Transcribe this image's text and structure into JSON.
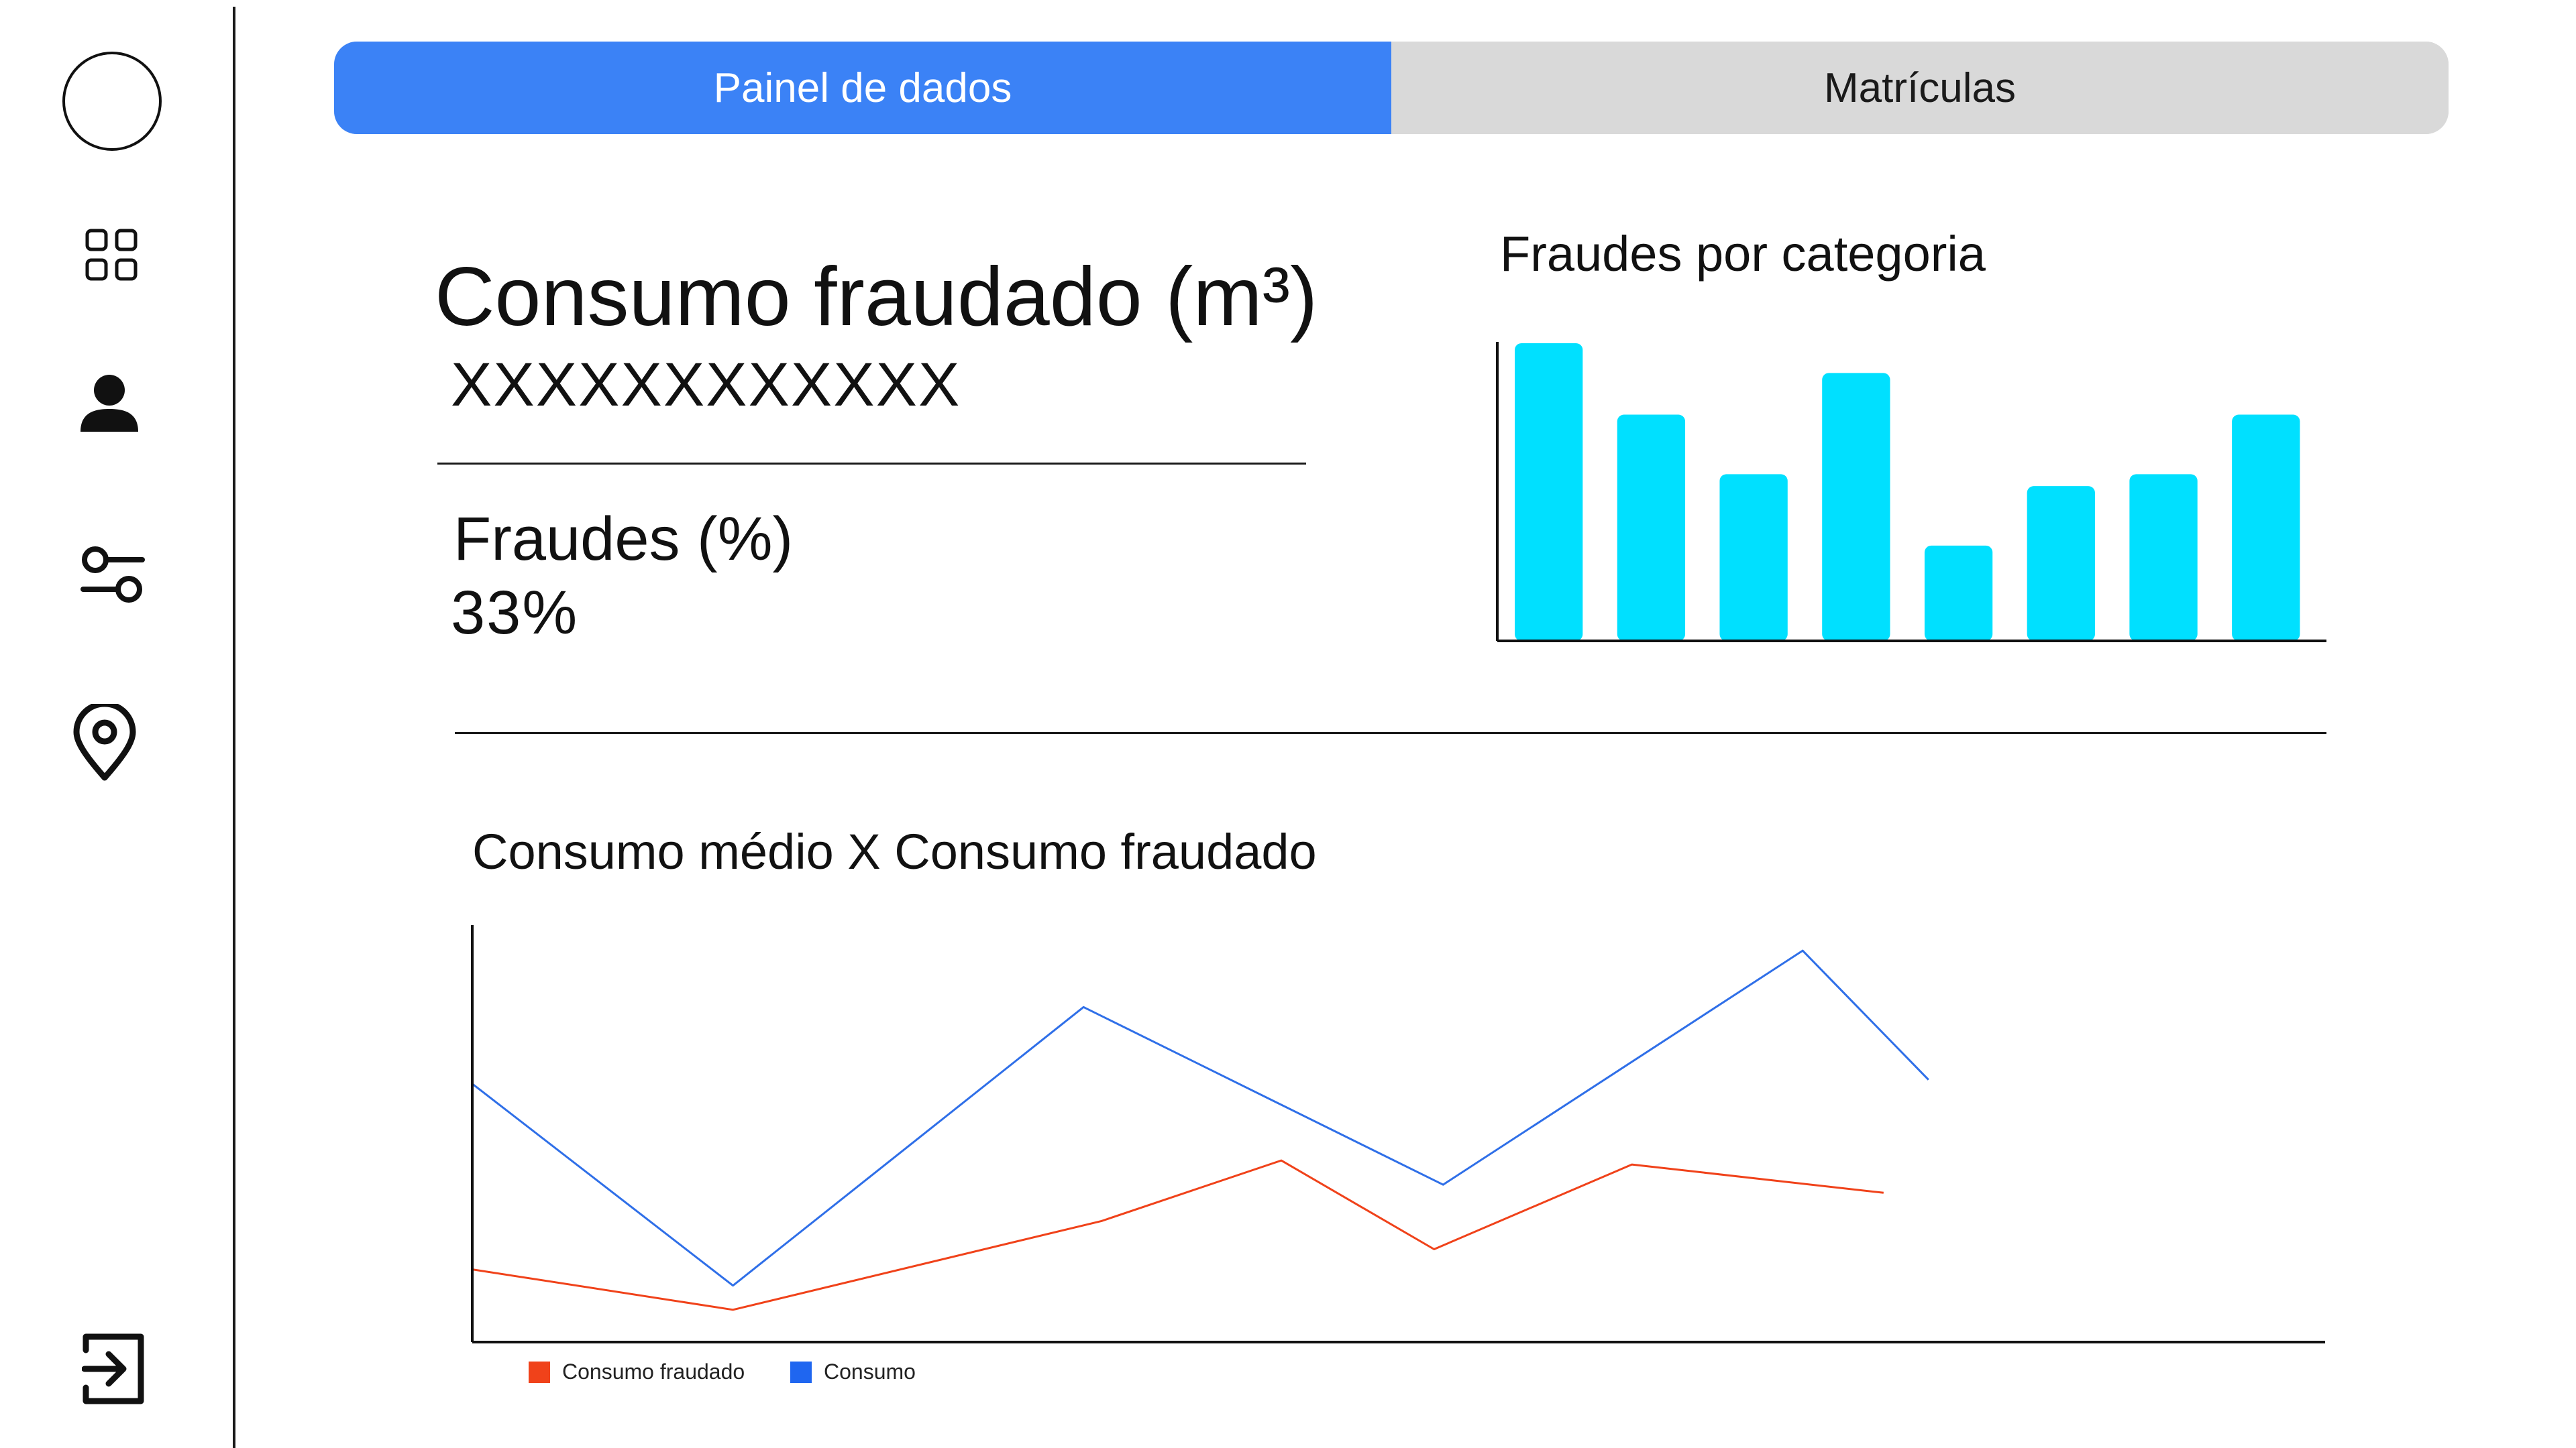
{
  "sidebar": {
    "icons": [
      "avatar-circle",
      "grid-icon",
      "user-icon",
      "sliders-icon",
      "location-pin-icon",
      "logout-icon"
    ]
  },
  "tabs": [
    {
      "label": "Painel de dados",
      "active": true
    },
    {
      "label": "Matrículas",
      "active": false
    }
  ],
  "kpis": {
    "consumo": {
      "title": "Consumo fraudado (m³)",
      "value": "XXXXXXXXXXXX"
    },
    "fraudes": {
      "title": "Fraudes (%)",
      "value": "33%"
    }
  },
  "colors": {
    "tab_active": "#3b82f6",
    "tab_inactive": "#d9d9d9",
    "bar": "#00e0ff",
    "consumo_line": "#2f6fe8",
    "fraude_line": "#f0421a"
  },
  "chart_data": [
    {
      "type": "bar",
      "title": "Fraudes por categoria",
      "xlabel": "",
      "ylabel": "",
      "categories": [
        "",
        "",
        "",
        "",
        "",
        "",
        "",
        ""
      ],
      "values": [
        100,
        76,
        56,
        90,
        32,
        52,
        56,
        76
      ],
      "ylim": [
        0,
        100
      ],
      "grid": false
    },
    {
      "type": "line",
      "title": "Consumo médio X Consumo fraudado",
      "xlabel": "",
      "ylabel": "",
      "series": [
        {
          "name": "Consumo fraudado",
          "color": "#f0421a",
          "points": [
            [
              0,
              18
            ],
            [
              1.45,
              8
            ],
            [
              3.5,
              30
            ],
            [
              4.5,
              45
            ],
            [
              5.35,
              23
            ],
            [
              6.45,
              44
            ],
            [
              7.85,
              37
            ]
          ]
        },
        {
          "name": "Consumo",
          "color": "#2f6fe8",
          "points": [
            [
              0,
              64
            ],
            [
              1.45,
              14
            ],
            [
              3.4,
              83
            ],
            [
              5.4,
              39
            ],
            [
              7.4,
              97
            ],
            [
              8.1,
              65
            ]
          ]
        }
      ],
      "xlim": [
        0,
        10
      ],
      "ylim": [
        0,
        100
      ],
      "legend_position": "bottom-left",
      "grid": false
    }
  ]
}
